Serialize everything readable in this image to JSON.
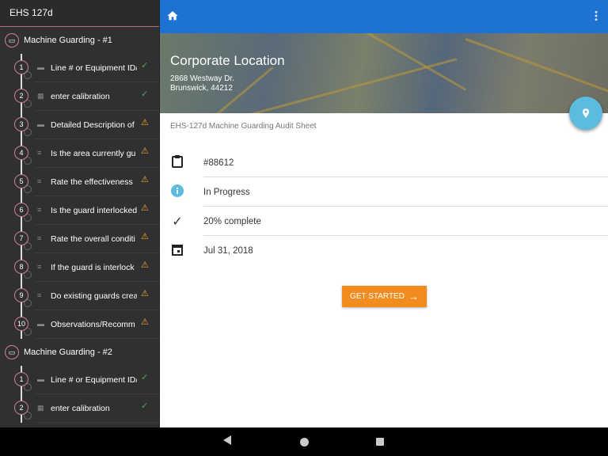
{
  "sidebar": {
    "title": "EHS 127d",
    "groups": [
      {
        "title": "Machine Guarding - #1",
        "items": [
          {
            "num": "1",
            "icon": "comment-icon",
            "label": "Line # or Equipment ID/",
            "status": "check"
          },
          {
            "num": "2",
            "icon": "calculator-icon",
            "label": "enter calibration",
            "status": "check"
          },
          {
            "num": "3",
            "icon": "comment-icon",
            "label": "Detailed Description of",
            "status": "warning"
          },
          {
            "num": "4",
            "icon": "list-icon",
            "label": "Is the area currently gu",
            "status": "warning"
          },
          {
            "num": "5",
            "icon": "list-icon",
            "label": "Rate the effectiveness",
            "status": "warning"
          },
          {
            "num": "6",
            "icon": "list-icon",
            "label": "Is the guard interlocked",
            "status": "warning"
          },
          {
            "num": "7",
            "icon": "list-icon",
            "label": "Rate the overall conditi",
            "status": "warning"
          },
          {
            "num": "8",
            "icon": "list-icon",
            "label": "If the guard is interlock",
            "status": "warning"
          },
          {
            "num": "9",
            "icon": "list-icon",
            "label": "Do existing guards crea",
            "status": "warning"
          },
          {
            "num": "10",
            "icon": "comment-icon",
            "label": "Observations/Recomm",
            "status": "warning"
          }
        ]
      },
      {
        "title": "Machine Guarding - #2",
        "items": [
          {
            "num": "1",
            "icon": "comment-icon",
            "label": "Line # or Equipment ID/",
            "status": "check"
          },
          {
            "num": "2",
            "icon": "calculator-icon",
            "label": "enter calibration",
            "status": "check"
          }
        ]
      }
    ]
  },
  "header": {
    "location": "Corporate Location",
    "address1": "2868 Westway Dr.",
    "address2": "Brunswick, 44212"
  },
  "main": {
    "subtitle": "EHS-127d Machine Guarding Audit Sheet",
    "id": "#88612",
    "status": "In Progress",
    "progress_text": "20% complete",
    "progress": 0.2,
    "date": "Jul 31, 2018",
    "start_label": "GET STARTED"
  },
  "colors": {
    "topbar": "#1e73d2",
    "accent": "#f28c1f",
    "fab": "#5bbcdf"
  }
}
